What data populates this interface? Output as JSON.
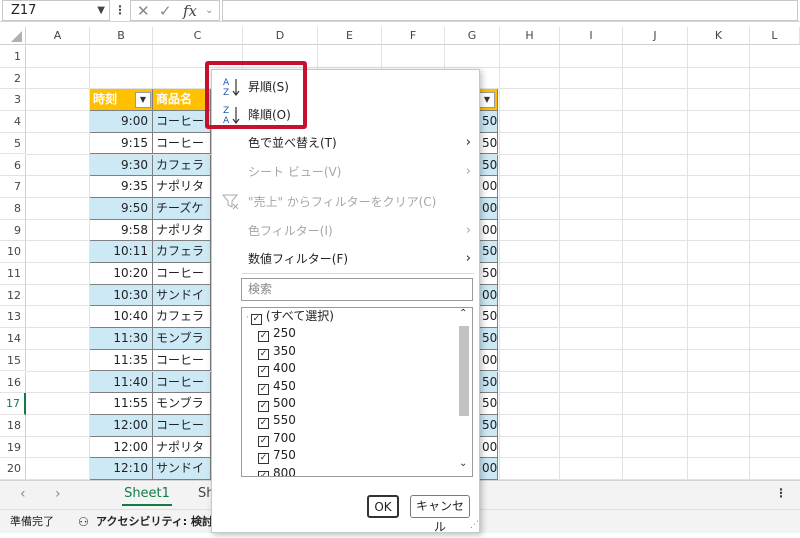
{
  "formula_bar": {
    "name_box": "Z17",
    "fx": "fx"
  },
  "columns": [
    "A",
    "B",
    "C",
    "D",
    "E",
    "F",
    "G",
    "H",
    "I",
    "J",
    "K",
    "L"
  ],
  "rows": [
    "1",
    "2",
    "3",
    "4",
    "5",
    "6",
    "7",
    "8",
    "9",
    "10",
    "11",
    "12",
    "13",
    "14",
    "15",
    "16",
    "17",
    "18",
    "19",
    "20"
  ],
  "table": {
    "header_time": "時刻",
    "header_name": "商品名",
    "header_sales_fill": "#ffc000",
    "band_color": "#cce9f5",
    "times": [
      "9:00",
      "9:15",
      "9:30",
      "9:35",
      "9:50",
      "9:58",
      "10:11",
      "10:20",
      "10:30",
      "10:40",
      "11:30",
      "11:35",
      "11:40",
      "11:55",
      "12:00",
      "12:00",
      "12:10"
    ],
    "names": [
      "コーヒー",
      "コーヒー",
      "カフェラ",
      "ナポリタ",
      "チーズケ",
      "ナポリタ",
      "カフェラ",
      "コーヒー",
      "サンドイ",
      "カフェラ",
      "モンブラ",
      "コーヒー",
      "コーヒー",
      "モンブラ",
      "コーヒー",
      "ナポリタ",
      "サンドイ"
    ],
    "sales_partial": [
      "50",
      "50",
      "50",
      "00",
      "00",
      "00",
      "50",
      "50",
      "00",
      "50",
      "50",
      "00",
      "50",
      "50",
      "50",
      "00",
      "00"
    ]
  },
  "menu": {
    "sort_asc": "昇順(S)",
    "sort_desc": "降順(O)",
    "sort_by_color": "色で並べ替え(T)",
    "sheet_view": "シート ビュー(V)",
    "clear_filter": "\"売上\" からフィルターをクリア(C)",
    "color_filter": "色フィルター(I)",
    "number_filter": "数値フィルター(F)",
    "search_placeholder": "検索",
    "items": [
      "(すべて選択)",
      "250",
      "350",
      "400",
      "450",
      "500",
      "550",
      "700",
      "750",
      "800"
    ],
    "ok": "OK",
    "cancel": "キャンセル",
    "highlight_color": "#c8102e"
  },
  "tabs": {
    "sheet1": "Sheet1",
    "sheet2_partial": "Sh"
  },
  "status": {
    "ready": "準備完了",
    "accessibility": "アクセシビリティ: 検討が"
  }
}
